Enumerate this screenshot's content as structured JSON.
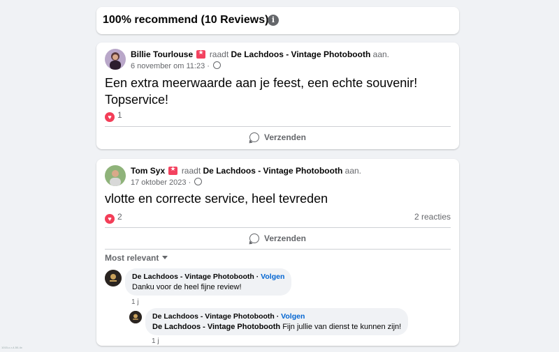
{
  "header": {
    "title": "100% recommend (10 Reviews)",
    "info_icon": "info-icon"
  },
  "review1": {
    "author": "Billie Tourlouse",
    "recommends_text": "raadt",
    "page": "De Lachdoos - Vintage Photobooth",
    "suffix": "aan.",
    "date": "6 november om 11:23",
    "separator": "·",
    "text_line1": "Een extra meerwaarde aan je feest, een echte souvenir!",
    "text_line2": "Topservice!",
    "reaction_count": "1",
    "send_label": "Verzenden"
  },
  "review2": {
    "author": "Tom Syx",
    "recommends_text": "raadt",
    "page": "De Lachdoos - Vintage Photobooth",
    "suffix": "aan.",
    "date": "17 oktober 2023",
    "separator": "·",
    "text": "vlotte en correcte service, heel tevreden",
    "reaction_count": "2",
    "comments_count": "2 reacties",
    "send_label": "Verzenden",
    "sort_label": "Most relevant",
    "comments": [
      {
        "author": "De Lachdoos - Vintage Photobooth",
        "follow": "Volgen",
        "text": "Danku voor de heel fijne review!",
        "time": "1 j"
      },
      {
        "author": "De Lachdoos - Vintage Photobooth",
        "follow": "Volgen",
        "mention": "De Lachdoos - Vintage Photobooth",
        "text": " Fijn jullie van dienst te kunnen zijn!",
        "time": "1 j"
      }
    ]
  },
  "colors": {
    "background": "#f0f2f5",
    "heart": "#f33e58",
    "link": "#0064d1",
    "recommend_badge": "#f3425f"
  },
  "watermark": "1015-c-r-4-50-4x"
}
